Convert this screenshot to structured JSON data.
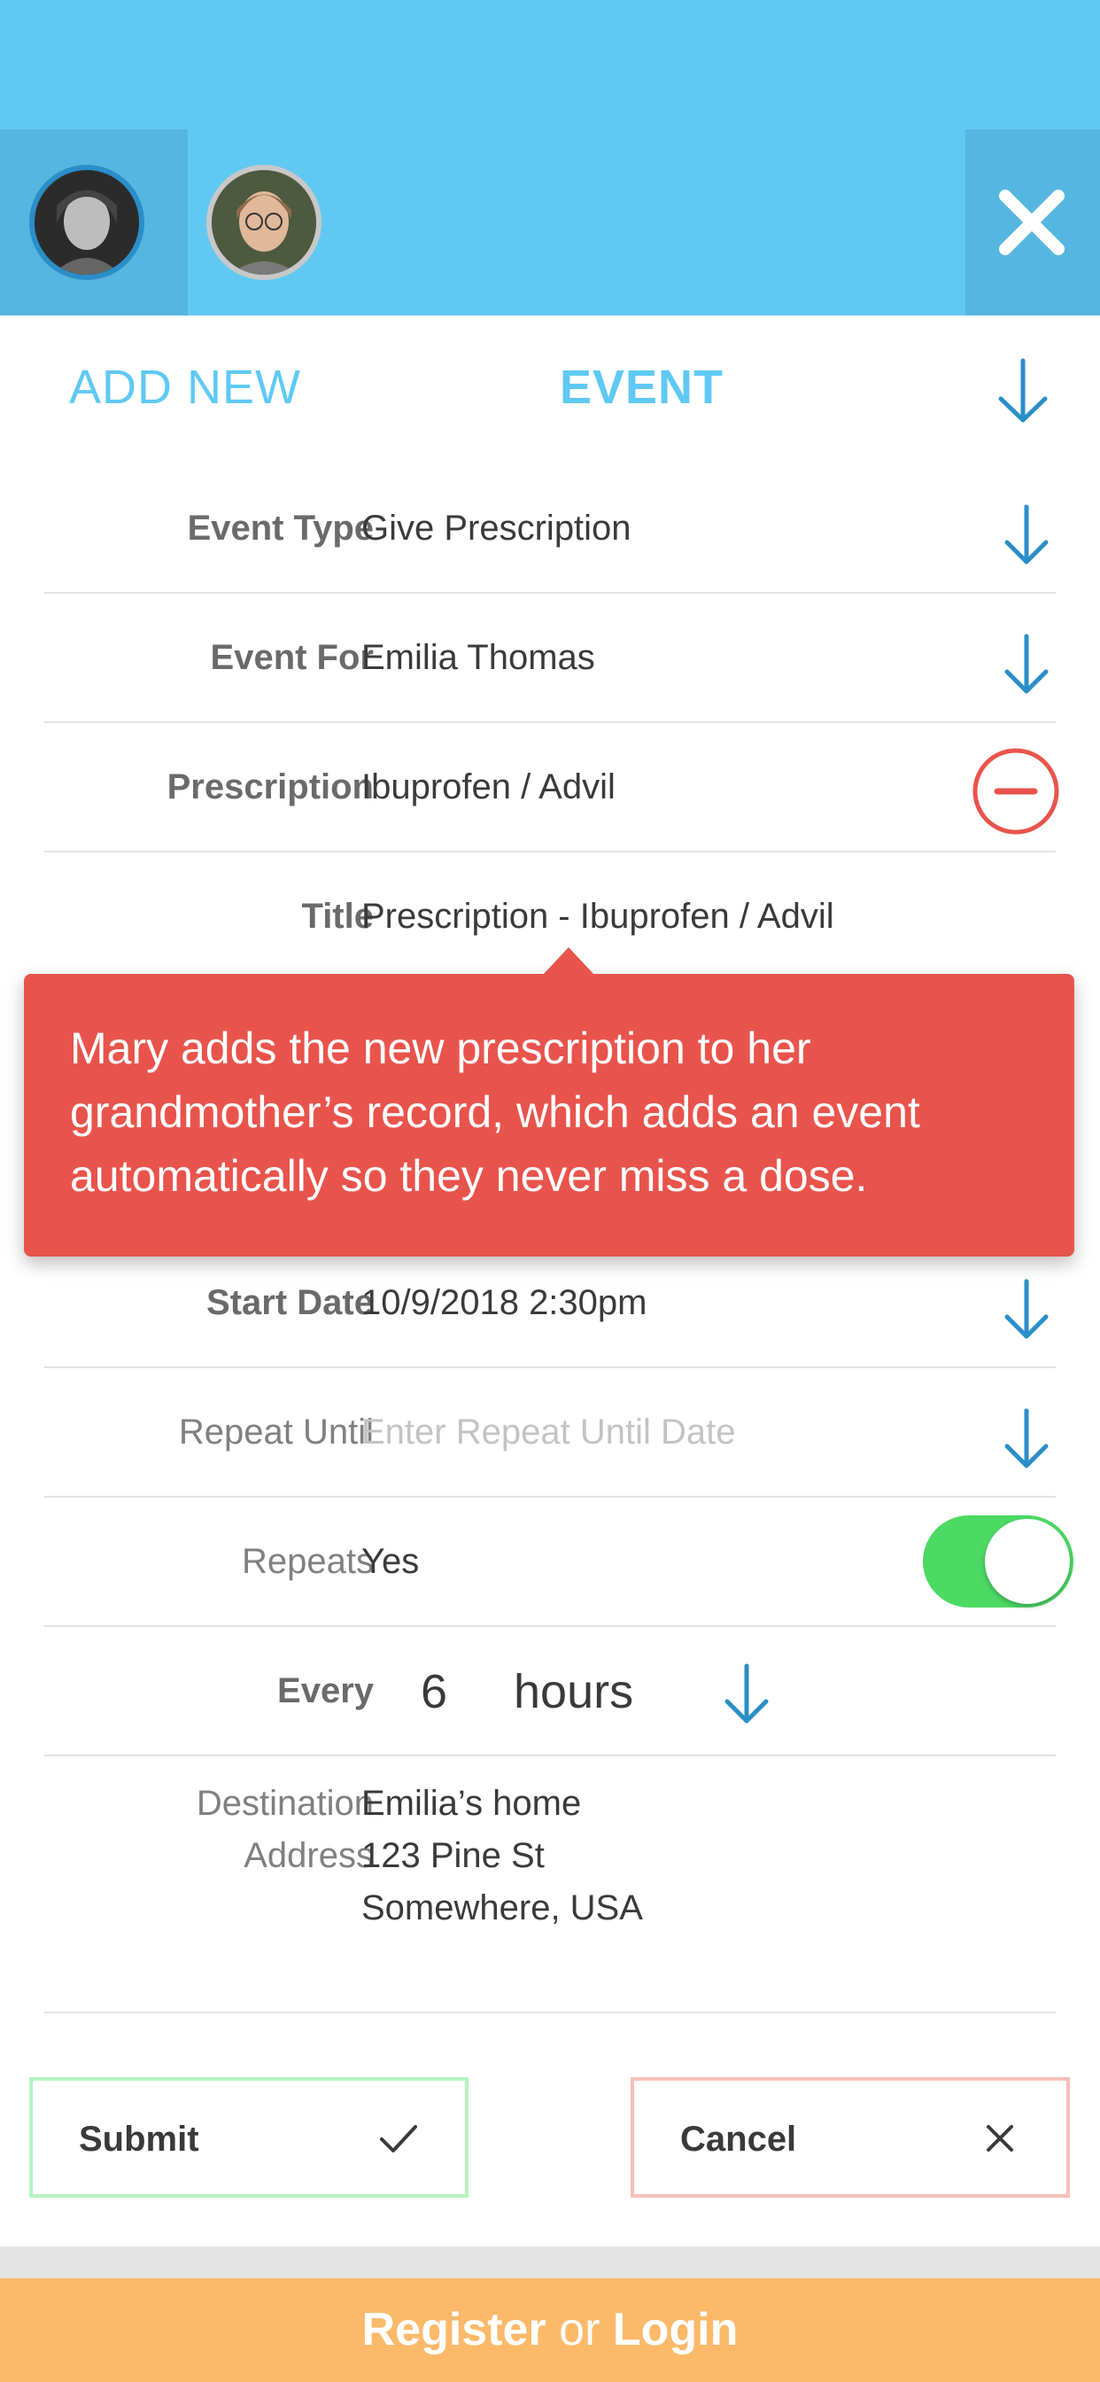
{
  "header": {
    "avatars": [
      "user-avatar-1",
      "user-avatar-2"
    ],
    "close_icon": "close-icon"
  },
  "tabs": {
    "add_new": "ADD NEW",
    "event": "EVENT"
  },
  "form": {
    "event_type": {
      "label": "Event Type",
      "value": "Give Prescription"
    },
    "event_for": {
      "label": "Event For",
      "value": "Emilia Thomas"
    },
    "prescription": {
      "label": "Prescription",
      "value": "Ibuprofen / Advil"
    },
    "title": {
      "label": "Title",
      "value": "Prescription - Ibuprofen / Advil"
    },
    "start_date": {
      "label": "Start Date",
      "value": "10/9/2018 2:30pm"
    },
    "repeat_until": {
      "label": "Repeat Until",
      "placeholder": "Enter Repeat Until Date"
    },
    "repeats": {
      "label": "Repeats",
      "value": "Yes",
      "toggle_on": true
    },
    "every": {
      "label": "Every",
      "number": "6",
      "unit": "hours"
    },
    "destination": {
      "label_line1": "Destination",
      "label_line2": "Address",
      "line1": "Emilia’s home",
      "line2": "123 Pine St",
      "line3": "Somewhere, USA"
    }
  },
  "tooltip": {
    "text": "Mary adds the new prescription to her grandmother’s record, which adds an event automatically so they never miss a dose."
  },
  "buttons": {
    "submit": "Submit",
    "cancel": "Cancel"
  },
  "footer": {
    "register": "Register",
    "or": "or",
    "login": "Login"
  },
  "colors": {
    "header_bg": "#5fc9f3",
    "accent_blue": "#2a8ec8",
    "tooltip_red": "#e8544c",
    "toggle_green": "#4cd964",
    "footer_orange": "#fbb969"
  }
}
